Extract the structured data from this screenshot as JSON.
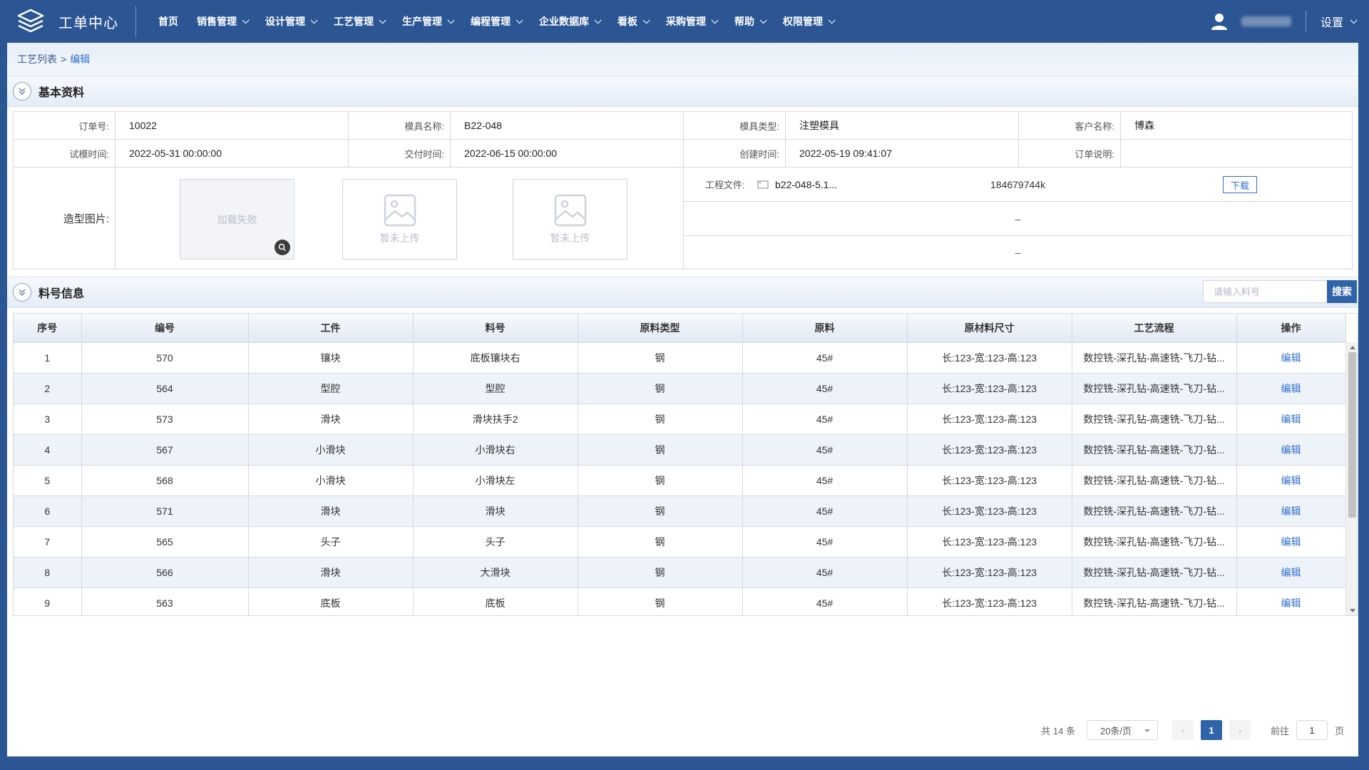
{
  "app": {
    "title": "工单中心",
    "settings_label": "设置"
  },
  "nav": [
    {
      "label": "首页",
      "has_menu": false
    },
    {
      "label": "销售管理",
      "has_menu": true
    },
    {
      "label": "设计管理",
      "has_menu": true
    },
    {
      "label": "工艺管理",
      "has_menu": true
    },
    {
      "label": "生产管理",
      "has_menu": true
    },
    {
      "label": "编程管理",
      "has_menu": true
    },
    {
      "label": "企业数据库",
      "has_menu": true
    },
    {
      "label": "看板",
      "has_menu": true
    },
    {
      "label": "采购管理",
      "has_menu": true
    },
    {
      "label": "帮助",
      "has_menu": true
    },
    {
      "label": "权限管理",
      "has_menu": true
    }
  ],
  "breadcrumb": {
    "parent": "工艺列表",
    "separator": ">",
    "current": "编辑"
  },
  "basic": {
    "title": "基本资料",
    "rows": [
      [
        {
          "label": "订单号:",
          "value": "10022"
        },
        {
          "label": "模具名称:",
          "value": "B22-048"
        },
        {
          "label": "模具类型:",
          "value": "注塑模具"
        },
        {
          "label": "客户名称:",
          "value": "博森"
        }
      ],
      [
        {
          "label": "试模时间:",
          "value": "2022-05-31 00:00:00"
        },
        {
          "label": "交付时间:",
          "value": "2022-06-15 00:00:00"
        },
        {
          "label": "创建时间:",
          "value": "2022-05-19 09:41:07"
        },
        {
          "label": "订单说明:",
          "value": ""
        }
      ]
    ],
    "image_label": "造型图片:",
    "images": [
      {
        "text": "加载失败",
        "state": "failed"
      },
      {
        "text": "暂未上传",
        "state": "empty"
      },
      {
        "text": "暂未上传",
        "state": "empty"
      }
    ],
    "file": {
      "label": "工程文件:",
      "name": "b22-048-5.1...",
      "size": "184679744k",
      "download_label": "下载"
    },
    "empty_rows": [
      "–",
      "–"
    ]
  },
  "parts": {
    "title": "料号信息",
    "search_placeholder": "请输入料号",
    "search_label": "搜索",
    "columns": [
      "序号",
      "编号",
      "工件",
      "料号",
      "原料类型",
      "原料",
      "原材料尺寸",
      "工艺流程",
      "操作"
    ],
    "rows": [
      [
        "1",
        "570",
        "镶块",
        "底板镶块右",
        "钢",
        "45#",
        "长:123-宽:123-高:123",
        "数控铣-深孔钻-高速铣-飞刀-钻...",
        "编辑"
      ],
      [
        "2",
        "564",
        "型腔",
        "型腔",
        "钢",
        "45#",
        "长:123-宽:123-高:123",
        "数控铣-深孔钻-高速铣-飞刀-钻...",
        "编辑"
      ],
      [
        "3",
        "573",
        "滑块",
        "滑块扶手2",
        "钢",
        "45#",
        "长:123-宽:123-高:123",
        "数控铣-深孔钻-高速铣-飞刀-钻...",
        "编辑"
      ],
      [
        "4",
        "567",
        "小滑块",
        "小滑块右",
        "钢",
        "45#",
        "长:123-宽:123-高:123",
        "数控铣-深孔钻-高速铣-飞刀-钻...",
        "编辑"
      ],
      [
        "5",
        "568",
        "小滑块",
        "小滑块左",
        "钢",
        "45#",
        "长:123-宽:123-高:123",
        "数控铣-深孔钻-高速铣-飞刀-钻...",
        "编辑"
      ],
      [
        "6",
        "571",
        "滑块",
        "滑块",
        "钢",
        "45#",
        "长:123-宽:123-高:123",
        "数控铣-深孔钻-高速铣-飞刀-钻...",
        "编辑"
      ],
      [
        "7",
        "565",
        "头子",
        "头子",
        "钢",
        "45#",
        "长:123-宽:123-高:123",
        "数控铣-深孔钻-高速铣-飞刀-钻...",
        "编辑"
      ],
      [
        "8",
        "566",
        "滑块",
        "大滑块",
        "钢",
        "45#",
        "长:123-宽:123-高:123",
        "数控铣-深孔钻-高速铣-飞刀-钻...",
        "编辑"
      ],
      [
        "9",
        "563",
        "底板",
        "底板",
        "钢",
        "45#",
        "长:123-宽:123-高:123",
        "数控铣-深孔钻-高速铣-飞刀-钻...",
        "编辑"
      ]
    ]
  },
  "pager": {
    "total": "共 14 条",
    "page_size": "20条/页",
    "current_page": "1",
    "goto_prefix": "前往",
    "goto_value": "1",
    "goto_suffix": "页"
  },
  "colors": {
    "header_bg": "#2c5693",
    "accent": "#2f64a8",
    "link": "#2f6fce"
  }
}
